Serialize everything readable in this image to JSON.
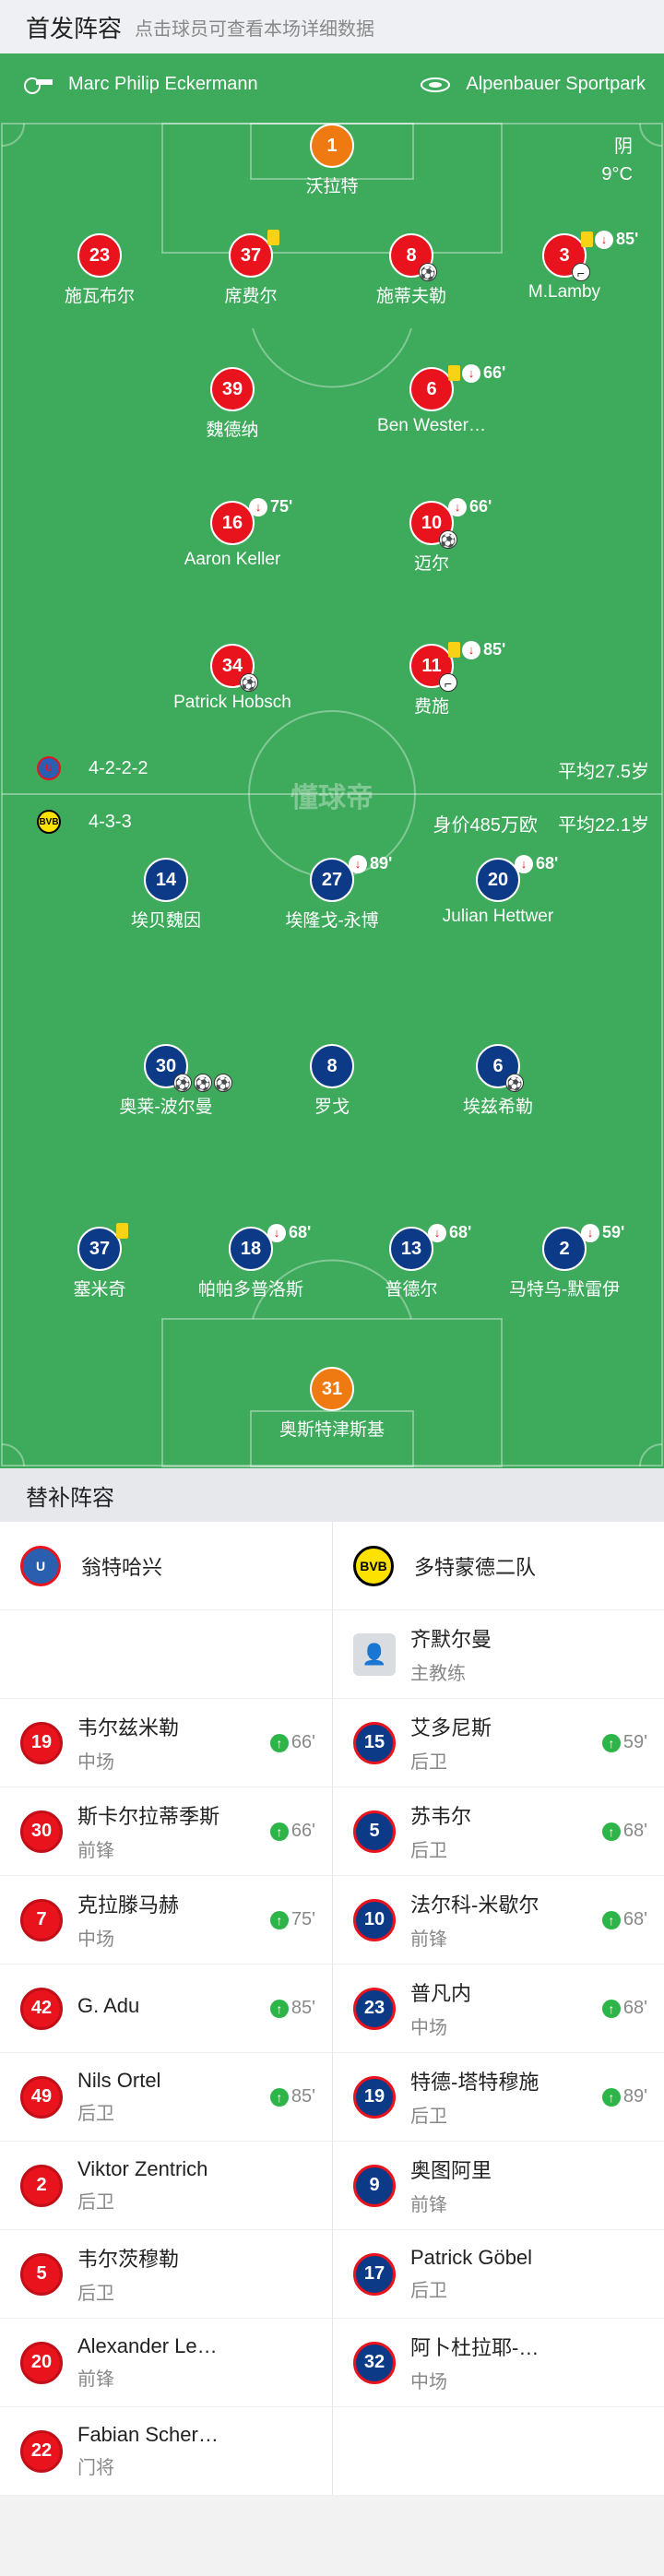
{
  "header": {
    "title": "首发阵容",
    "subtitle": "点击球员可查看本场详细数据"
  },
  "referee": {
    "name": "Marc Philip Eckermann",
    "icon": "whistle-icon"
  },
  "venue": {
    "name": "Alpenbauer Sportpark",
    "icon": "stadium-icon"
  },
  "weather": {
    "condition": "阴",
    "temp": "9°C"
  },
  "watermark": "懂球帝",
  "home_formation": {
    "formation": "4-2-2-2",
    "avg_age": "平均27.5岁"
  },
  "away_formation": {
    "formation": "4-3-3",
    "value": "身价485万欧",
    "avg_age": "平均22.1岁"
  },
  "home_players": [
    {
      "num": "1",
      "name": "沃拉特"
    },
    {
      "num": "23",
      "name": "施瓦布尔"
    },
    {
      "num": "37",
      "name": "席费尔"
    },
    {
      "num": "8",
      "name": "施蒂夫勒"
    },
    {
      "num": "3",
      "name": "M.Lamby",
      "minute": "85'"
    },
    {
      "num": "39",
      "name": "魏德纳"
    },
    {
      "num": "6",
      "name": "Ben Wester…",
      "minute": "66'"
    },
    {
      "num": "16",
      "name": "Aaron Keller",
      "minute": "75'"
    },
    {
      "num": "10",
      "name": "迈尔",
      "minute": "66'"
    },
    {
      "num": "34",
      "name": "Patrick Hobsch"
    },
    {
      "num": "11",
      "name": "费施",
      "minute": "85'"
    }
  ],
  "away_players": [
    {
      "num": "14",
      "name": "埃贝魏因"
    },
    {
      "num": "27",
      "name": "埃隆戈-永博",
      "minute": "89'"
    },
    {
      "num": "20",
      "name": "Julian Hettwer",
      "minute": "68'"
    },
    {
      "num": "30",
      "name": "奥莱-波尔曼"
    },
    {
      "num": "8",
      "name": "罗戈"
    },
    {
      "num": "6",
      "name": "埃兹希勒"
    },
    {
      "num": "37",
      "name": "塞米奇"
    },
    {
      "num": "18",
      "name": "帕帕多普洛斯",
      "minute": "68'"
    },
    {
      "num": "13",
      "name": "普德尔",
      "minute": "68'"
    },
    {
      "num": "2",
      "name": "马特乌-默雷伊",
      "minute": "59'"
    },
    {
      "num": "31",
      "name": "奥斯特津斯基"
    }
  ],
  "subs": {
    "title": "替补阵容",
    "home_team": "翁特哈兴",
    "away_team": "多特蒙德二队",
    "coach": {
      "name": "齐默尔曼",
      "role": "主教练"
    },
    "home": [
      {
        "num": "19",
        "name": "韦尔兹米勒",
        "pos": "中场",
        "in": "66'"
      },
      {
        "num": "30",
        "name": "斯卡尔拉蒂季斯",
        "pos": "前锋",
        "in": "66'"
      },
      {
        "num": "7",
        "name": "克拉滕马赫",
        "pos": "中场",
        "in": "75'"
      },
      {
        "num": "42",
        "name": "G. Adu",
        "pos": "",
        "in": "85'"
      },
      {
        "num": "49",
        "name": "Nils Ortel",
        "pos": "后卫",
        "in": "85'"
      },
      {
        "num": "2",
        "name": "Viktor Zentrich",
        "pos": "后卫"
      },
      {
        "num": "5",
        "name": "韦尔茨穆勒",
        "pos": "后卫"
      },
      {
        "num": "20",
        "name": "Alexander Le…",
        "pos": "前锋"
      },
      {
        "num": "22",
        "name": "Fabian Scher…",
        "pos": "门将"
      }
    ],
    "away": [
      {
        "num": "15",
        "name": "艾多尼斯",
        "pos": "后卫",
        "in": "59'"
      },
      {
        "num": "5",
        "name": "苏韦尔",
        "pos": "后卫",
        "in": "68'"
      },
      {
        "num": "10",
        "name": "法尔科-米歇尔",
        "pos": "前锋",
        "in": "68'"
      },
      {
        "num": "23",
        "name": "普凡内",
        "pos": "中场",
        "in": "68'"
      },
      {
        "num": "19",
        "name": "特德-塔特穆施",
        "pos": "后卫",
        "in": "89'"
      },
      {
        "num": "9",
        "name": "奥图阿里",
        "pos": "前锋"
      },
      {
        "num": "17",
        "name": "Patrick Göbel",
        "pos": "后卫"
      },
      {
        "num": "32",
        "name": "阿卜杜拉耶-…",
        "pos": "中场"
      }
    ]
  },
  "colors": {
    "pitch": "#3eab5c",
    "home": "#e8131d",
    "away": "#0c3a87",
    "gk": "#f07a12",
    "sub_in": "#2db54a"
  }
}
